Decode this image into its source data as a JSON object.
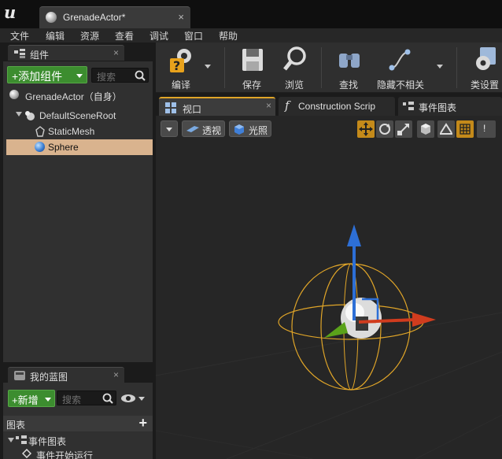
{
  "window": {
    "tab_title": "GrenadeActor*",
    "tab_close": "×"
  },
  "menu": [
    "文件",
    "编辑",
    "资源",
    "查看",
    "调试",
    "窗口",
    "帮助"
  ],
  "components_panel": {
    "tab_label": "组件",
    "add_button": "+添加组件",
    "search_placeholder": "搜索",
    "root_label": "GrenadeActor（自身）",
    "tree": [
      {
        "label": "DefaultSceneRoot",
        "icon": "scene-root-icon"
      },
      {
        "label": "StaticMesh",
        "icon": "static-mesh-icon"
      },
      {
        "label": "Sphere",
        "icon": "sphere-icon",
        "selected": true
      }
    ]
  },
  "my_blueprint_panel": {
    "tab_label": "我的蓝图",
    "new_button": "+新增",
    "search_placeholder": "搜索",
    "graphs_header": "图表",
    "event_graph": "事件图表",
    "event_begin": "事件开始运行"
  },
  "toolbar": {
    "compile": "编译",
    "save": "保存",
    "browse": "浏览",
    "find": "查找",
    "hide_unrelated": "隐藏不相关",
    "class_settings": "类设置"
  },
  "editor_tabs": [
    {
      "label": "视口",
      "icon": "viewport-icon"
    },
    {
      "label": "Construction Scrip",
      "icon": "function-icon"
    },
    {
      "label": "事件图表",
      "icon": "graph-icon"
    }
  ],
  "viewport": {
    "perspective": "透视",
    "lit": "光照"
  },
  "colors": {
    "selection": "#d9b38e",
    "green_button": "#3c8d2f",
    "gizmo_orange": "#e0a528",
    "axis_x": "#d03c1e",
    "axis_y": "#5aa21a",
    "axis_z": "#2d6fd6"
  }
}
